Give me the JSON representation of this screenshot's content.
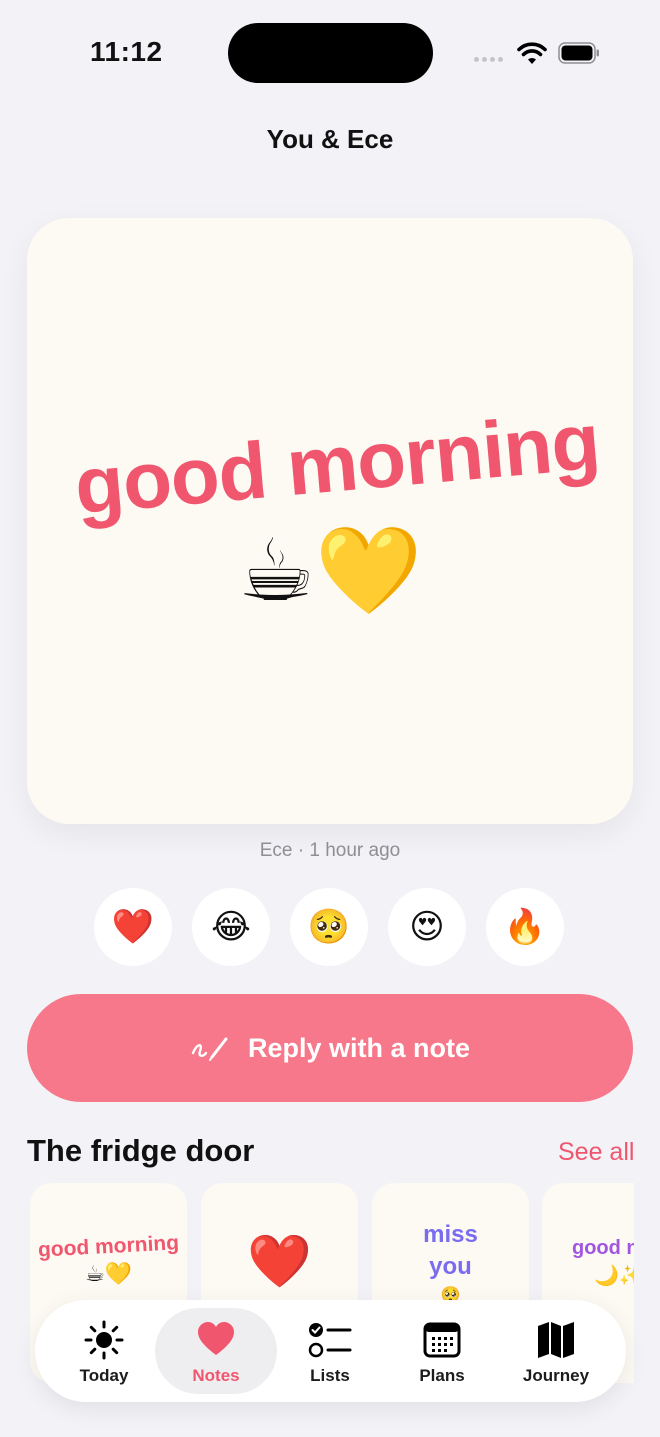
{
  "status_bar": {
    "time": "11:12"
  },
  "header": {
    "title": "You & Ece"
  },
  "note": {
    "text": "good morning",
    "emoji": "☕💛",
    "meta": "Ece · 1 hour ago"
  },
  "reactions": [
    "❤️",
    "😂",
    "🥺",
    "😍",
    "🔥"
  ],
  "reply": {
    "label": "Reply with a note",
    "icon": "pen-scribble-icon"
  },
  "fridge": {
    "title": "The fridge door",
    "see_all": "See all",
    "cards": [
      {
        "text": "good morning",
        "emoji": "☕💛",
        "color": "#f0576f"
      },
      {
        "text": "",
        "emoji": "❤️",
        "color": "#f0576f"
      },
      {
        "text": "miss you",
        "emoji": "🥺",
        "color": "#7a6cf0"
      },
      {
        "text": "good n",
        "emoji": "🌙✨",
        "color": "#a155e0"
      }
    ]
  },
  "tabs": [
    {
      "label": "Today",
      "icon": "sun-icon",
      "active": false
    },
    {
      "label": "Notes",
      "icon": "heart-icon",
      "active": true
    },
    {
      "label": "Lists",
      "icon": "checklist-icon",
      "active": false
    },
    {
      "label": "Plans",
      "icon": "calendar-icon",
      "active": false
    },
    {
      "label": "Journey",
      "icon": "map-icon",
      "active": false
    }
  ],
  "colors": {
    "accent": "#f0576f",
    "reply_button": "#f6788a",
    "note_bg": "#fdf9f3",
    "page_bg": "#f2f2f7"
  }
}
